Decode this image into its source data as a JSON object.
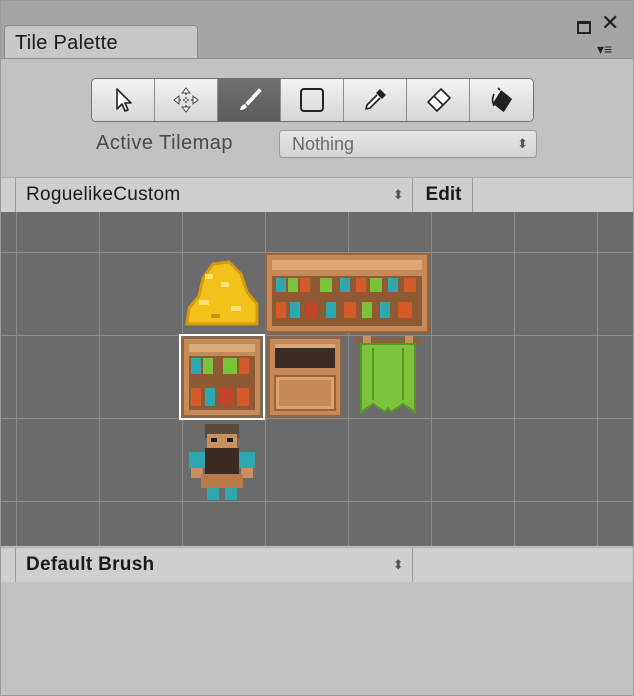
{
  "window": {
    "tab_title": "Tile Palette",
    "controls": {
      "maximize_icon": "maximize-icon",
      "close_glyph": "✕",
      "menu_glyph": "▾≡"
    }
  },
  "toolbar": {
    "tools": [
      {
        "name": "select-tool",
        "icon": "arrow-pointer-icon"
      },
      {
        "name": "move-tool",
        "icon": "move-arrows-icon"
      },
      {
        "name": "paint-tool",
        "icon": "paintbrush-icon",
        "active": true
      },
      {
        "name": "box-fill-tool",
        "icon": "rectangle-icon"
      },
      {
        "name": "picker-tool",
        "icon": "eyedropper-icon"
      },
      {
        "name": "erase-tool",
        "icon": "eraser-icon"
      },
      {
        "name": "flood-fill-tool",
        "icon": "paint-bucket-icon"
      }
    ]
  },
  "active_tilemap": {
    "label": "Active Tilemap",
    "value": "Nothing"
  },
  "palette": {
    "selected": "RoguelikeCustom",
    "edit_label": "Edit"
  },
  "brush": {
    "selected": "Default Brush"
  },
  "tiles": [
    {
      "name": "gold-pile-tile",
      "kind": "gold"
    },
    {
      "name": "bookshelf-wide-tile",
      "kind": "bookshelf-wide"
    },
    {
      "name": "bookshelf-tile",
      "kind": "bookshelf",
      "selected": true
    },
    {
      "name": "dresser-tile",
      "kind": "dresser"
    },
    {
      "name": "green-banner-tile",
      "kind": "banner"
    },
    {
      "name": "dwarf-character-tile",
      "kind": "dwarf"
    }
  ],
  "colors": {
    "grid_bg": "#6b6b6b",
    "grid_line": "#8c8c8c",
    "active_tool": "#636363",
    "wood": "#b97a4b",
    "gold": "#f2c21a",
    "banner": "#7cc23a"
  }
}
